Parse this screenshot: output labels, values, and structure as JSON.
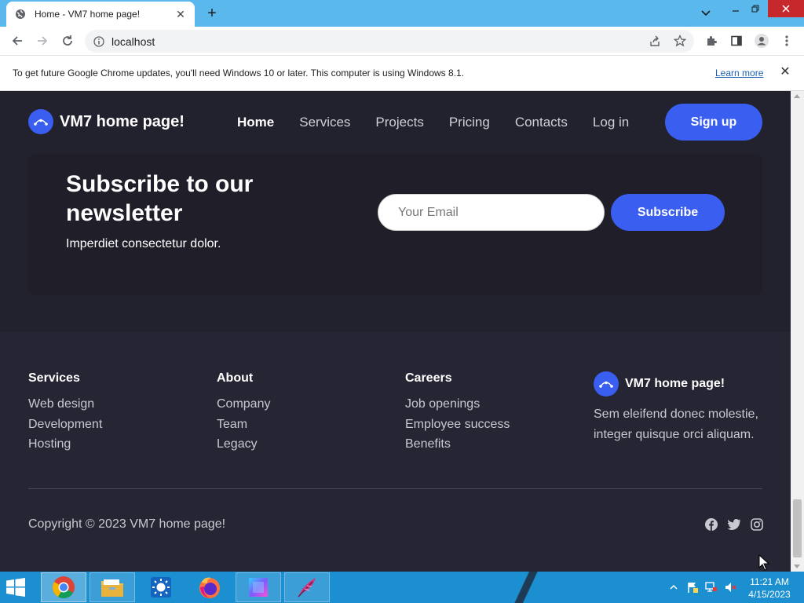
{
  "browser": {
    "tab_title": "Home - VM7 home page!",
    "url": "localhost",
    "new_tab_symbol": "+",
    "close_symbol": "✕",
    "infobar": {
      "message": "To get future Google Chrome updates, you'll need Windows 10 or later. This computer is using Windows 8.1.",
      "learn_more": "Learn more"
    }
  },
  "site": {
    "brand": "VM7 home page!",
    "nav": [
      "Home",
      "Services",
      "Projects",
      "Pricing",
      "Contacts",
      "Log in"
    ],
    "active_nav": "Home",
    "signup_label": "Sign up",
    "accent_color": "#3a5ef0",
    "newsletter": {
      "title": "Subscribe to our newsletter",
      "subtitle": "Imperdiet consectetur dolor.",
      "email_placeholder": "Your Email",
      "button": "Subscribe"
    },
    "footer": {
      "columns": [
        {
          "heading": "Services",
          "links": [
            "Web design",
            "Development",
            "Hosting"
          ]
        },
        {
          "heading": "About",
          "links": [
            "Company",
            "Team",
            "Legacy"
          ]
        },
        {
          "heading": "Careers",
          "links": [
            "Job openings",
            "Employee success",
            "Benefits"
          ]
        }
      ],
      "brand_name": "VM7 home page!",
      "brand_description": "Sem eleifend donec molestie, integer quisque orci aliquam.",
      "copyright": "Copyright © 2023 VM7 home page!",
      "social_icons": [
        "facebook-icon",
        "twitter-icon",
        "instagram-icon"
      ]
    }
  },
  "taskbar": {
    "apps": [
      "chrome",
      "file-explorer",
      "app-sun",
      "firefox",
      "app-square",
      "app-feather"
    ],
    "time": "11:21 AM",
    "date": "4/15/2023"
  }
}
